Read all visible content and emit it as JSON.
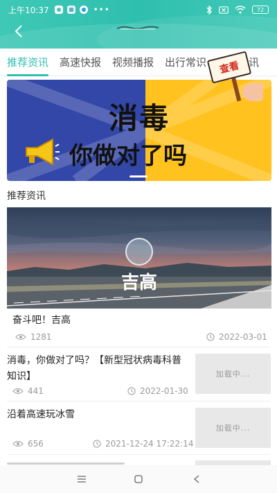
{
  "status_bar": {
    "time": "上午10:37",
    "battery": "72"
  },
  "icons": {
    "back": "chevron-left-icon",
    "view": "eye-icon",
    "clock": "clock-icon"
  },
  "tabs": [
    {
      "label": "推荐资讯",
      "active": true
    },
    {
      "label": "高速快报",
      "active": false
    },
    {
      "label": "视频播报",
      "active": false
    },
    {
      "label": "出行常识",
      "active": false
    },
    {
      "label": "政策资讯",
      "active": false
    }
  ],
  "colors": {
    "accent": "#2fbfae",
    "banner_blue": "#3347a8",
    "banner_yellow": "#ffc21f"
  },
  "banner": {
    "title_line1": "消毒",
    "title_line2": "你做对了吗",
    "sign_text": "查看"
  },
  "section": {
    "title": "推荐资讯"
  },
  "featured": {
    "image_text": "吉高",
    "title": "奋斗吧！吉高",
    "views": "1281",
    "date": "2022-03-01"
  },
  "articles": [
    {
      "title": "消毒，你做对了吗？【新型冠状病毒科普知识】",
      "views": "441",
      "date": "2022-01-30",
      "thumb_text": "加载中..."
    },
    {
      "title": "沿着高速玩冰雪",
      "views": "656",
      "date": "2021-12-24 17:22:14",
      "thumb_text": "加载中..."
    }
  ]
}
